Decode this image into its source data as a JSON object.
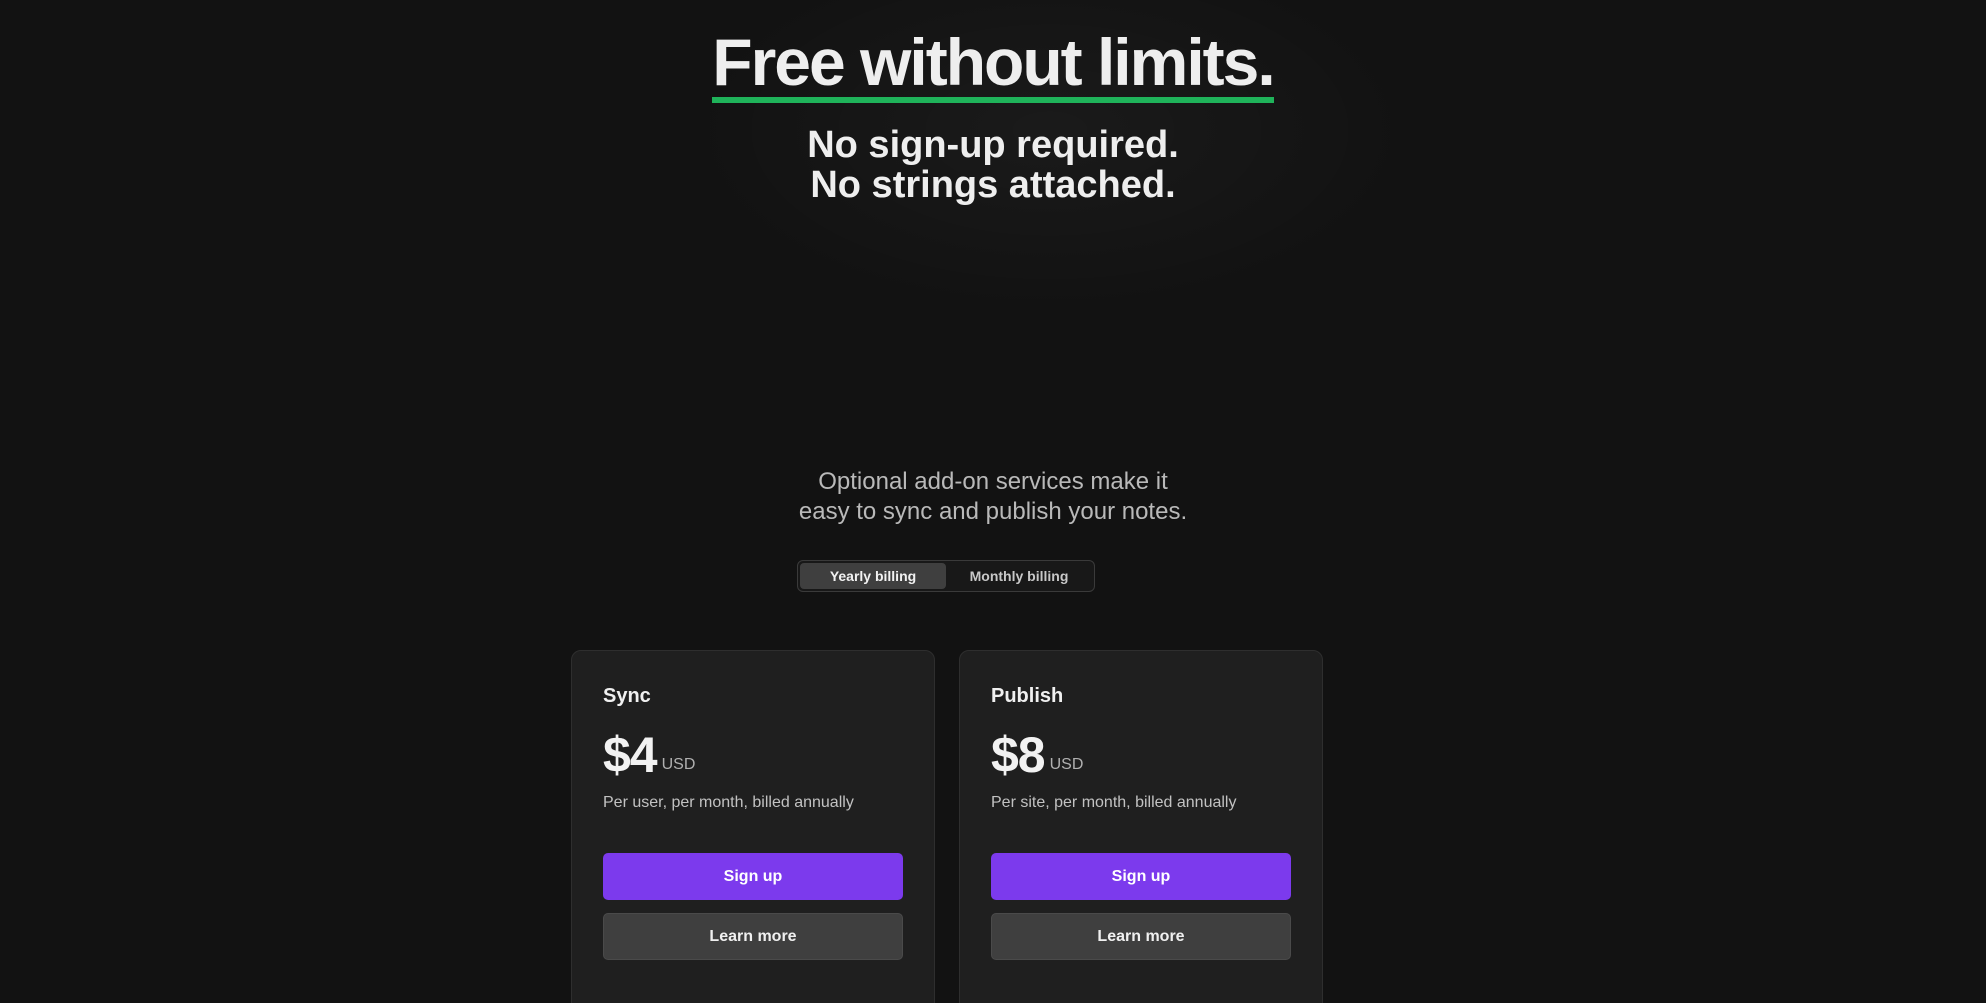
{
  "hero": {
    "title": "Free without limits.",
    "subtitle_line1": "No sign-up required.",
    "subtitle_line2": "No strings attached.",
    "underline_color": "#1fb35a"
  },
  "addons": {
    "line1": "Optional add-on services make it",
    "line2": "easy to sync and publish your notes."
  },
  "billing_toggle": {
    "options": [
      "Yearly billing",
      "Monthly billing"
    ],
    "selected": "Yearly billing"
  },
  "plans": [
    {
      "name": "Sync",
      "price": "$4",
      "currency": "USD",
      "note": "Per user, per month, billed annually",
      "primary_label": "Sign up",
      "secondary_label": "Learn more"
    },
    {
      "name": "Publish",
      "price": "$8",
      "currency": "USD",
      "note": "Per site, per month, billed annually",
      "primary_label": "Sign up",
      "secondary_label": "Learn more"
    }
  ],
  "colors": {
    "background": "#121212",
    "card": "#1f1f1f",
    "accent": "#7c3aed",
    "secondary_button": "#3f3f3f"
  }
}
